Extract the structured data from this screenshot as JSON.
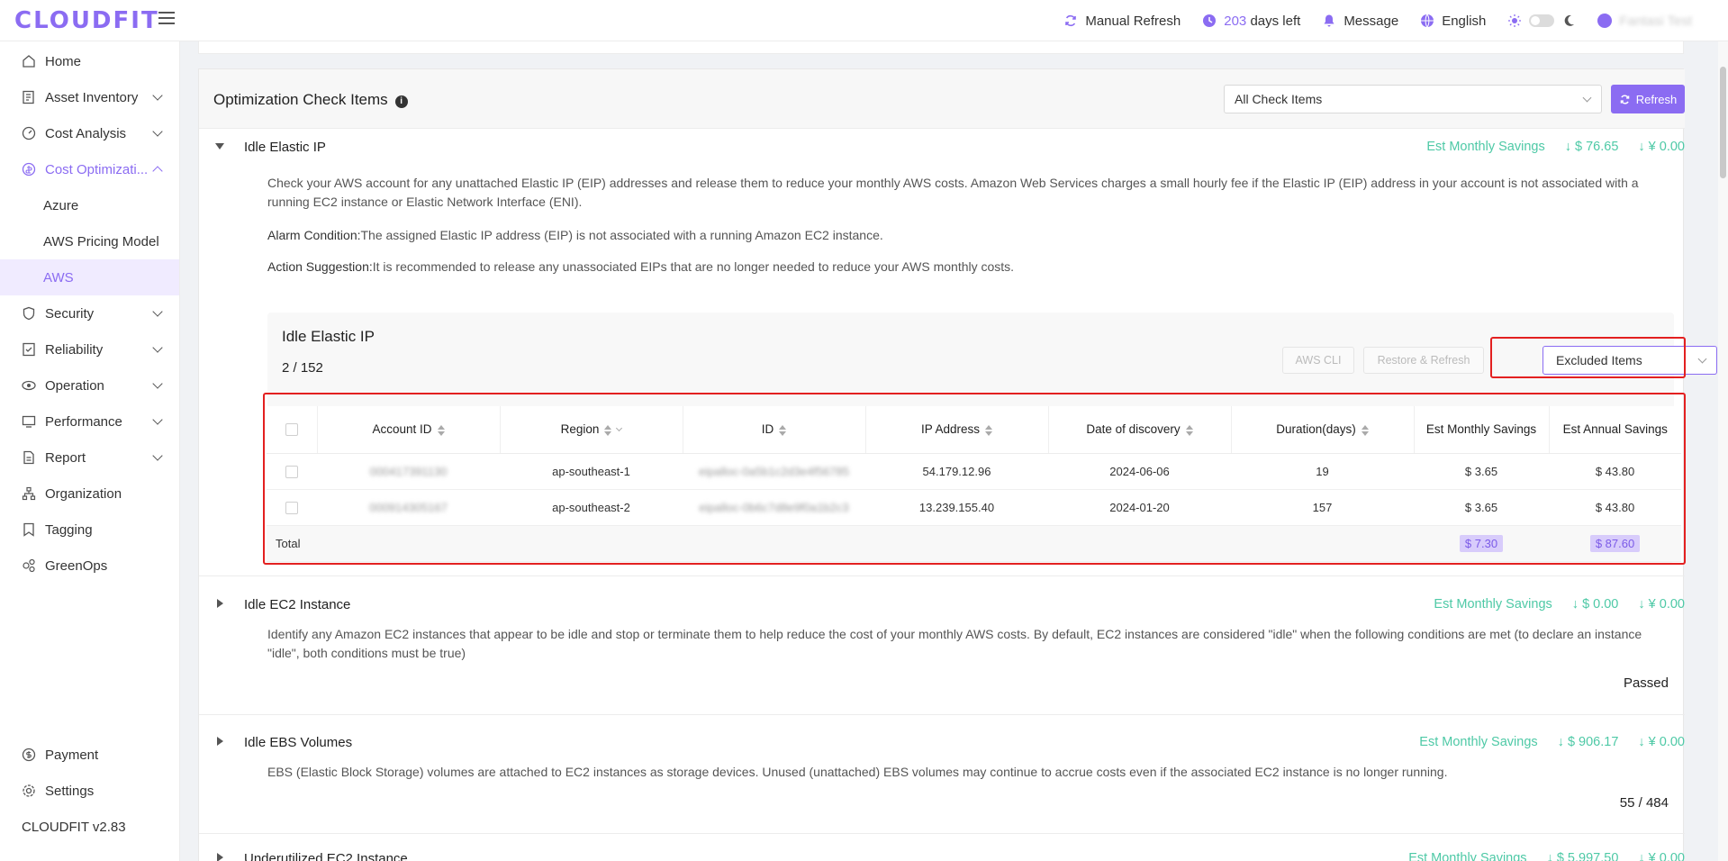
{
  "app": {
    "logo": "CLOUDFIT"
  },
  "header": {
    "manual_refresh": "Manual Refresh",
    "days_num": "203",
    "days_text": "days left",
    "message": "Message",
    "language": "English",
    "user": "Fantasi Test"
  },
  "sidebar": {
    "items": [
      {
        "label": "Home",
        "icon": "home-icon"
      },
      {
        "label": "Asset Inventory",
        "icon": "inventory-icon"
      },
      {
        "label": "Cost Analysis",
        "icon": "analysis-icon"
      },
      {
        "label": "Cost Optimizati...",
        "icon": "optimization-icon"
      },
      {
        "label": "Security",
        "icon": "shield-icon"
      },
      {
        "label": "Reliability",
        "icon": "reliability-icon"
      },
      {
        "label": "Operation",
        "icon": "operation-icon"
      },
      {
        "label": "Performance",
        "icon": "performance-icon"
      },
      {
        "label": "Report",
        "icon": "report-icon"
      },
      {
        "label": "Organization",
        "icon": "organization-icon"
      },
      {
        "label": "Tagging",
        "icon": "tag-icon"
      },
      {
        "label": "GreenOps",
        "icon": "greenops-icon"
      }
    ],
    "sub_items": [
      "Azure",
      "AWS Pricing Model",
      "AWS"
    ],
    "bottom": [
      {
        "label": "Payment",
        "icon": "payment-icon"
      },
      {
        "label": "Settings",
        "icon": "gear-icon"
      }
    ],
    "version": "CLOUDFIT v2.83"
  },
  "main": {
    "title": "Optimization Check Items",
    "filter_value": "All Check Items",
    "refresh_label": "Refresh",
    "savings_label": "Est Monthly Savings",
    "sections": [
      {
        "title": "Idle Elastic IP",
        "usd": "$ 76.65",
        "cny": "¥ 0.00",
        "desc": "Check your AWS account for any unattached Elastic IP (EIP) addresses and release them to reduce your monthly AWS costs. Amazon Web Services charges a small hourly fee if the Elastic IP (EIP) address in your account is not associated with a running EC2 instance or Elastic Network Interface (ENI).",
        "alarm_label": "Alarm Condition:",
        "alarm_text": "The assigned Elastic IP address (EIP) is not associated with a running Amazon EC2 instance.",
        "action_label": "Action Suggestion:",
        "action_text": "It is recommended to release any unassociated EIPs that are no longer needed to reduce your AWS monthly costs."
      },
      {
        "title": "Idle EC2 Instance",
        "usd": "$ 0.00",
        "cny": "¥ 0.00",
        "desc": "Identify any Amazon EC2 instances that appear to be idle and stop or terminate them to help reduce the cost of your monthly AWS costs. By default, EC2 instances are considered \"idle\" when the following conditions are met (to declare an instance \"idle\", both conditions must be true)",
        "status": "Passed"
      },
      {
        "title": "Idle EBS Volumes",
        "usd": "$ 906.17",
        "cny": "¥ 0.00",
        "desc": "EBS (Elastic Block Storage) volumes are attached to EC2 instances as storage devices. Unused (unattached) EBS volumes may continue to accrue costs even if the associated EC2 instance is no longer running.",
        "status": "55 / 484"
      },
      {
        "title": "Underutilized EC2 Instance",
        "usd": "$ 5,997.50",
        "cny": "¥ 0.00"
      }
    ],
    "inner": {
      "title": "Idle Elastic IP",
      "count": "2 / 152",
      "aws_cli": "AWS CLI",
      "restore_refresh": "Restore & Refresh",
      "excluded": "Excluded Items",
      "columns": [
        "Account ID",
        "Region",
        "ID",
        "IP Address",
        "Date of discovery",
        "Duration(days)",
        "Est Monthly Savings",
        "Est Annual Savings"
      ],
      "rows": [
        {
          "account": "000417391130",
          "region": "ap-southeast-1",
          "id": "eipalloc-0a5b1c2d3e4f56785",
          "ip": "54.179.12.96",
          "date": "2024-06-06",
          "duration": "19",
          "monthly": "$ 3.65",
          "annual": "$ 43.80"
        },
        {
          "account": "000914305167",
          "region": "ap-southeast-2",
          "id": "eipalloc-0b6c7d8e9f0a1b2c3",
          "ip": "13.239.155.40",
          "date": "2024-01-20",
          "duration": "157",
          "monthly": "$ 3.65",
          "annual": "$ 43.80"
        }
      ],
      "total_label": "Total",
      "total_monthly": "$ 7.30",
      "total_annual": "$ 87.60"
    }
  },
  "colors": {
    "accent": "#8b6cf2",
    "savings": "#4ec9a6",
    "highlight": "#e32020"
  }
}
